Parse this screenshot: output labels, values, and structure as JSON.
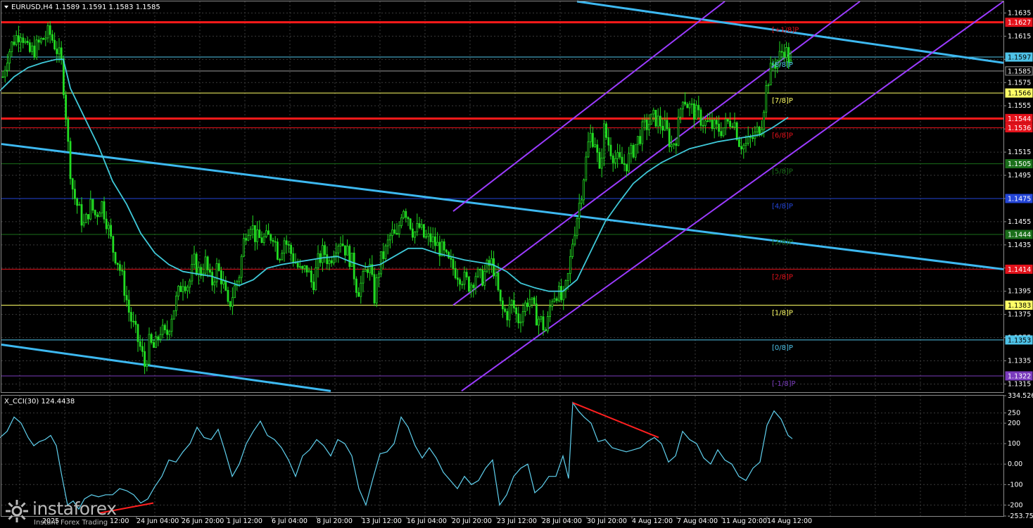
{
  "window": {
    "title": "EURUSD,H4  1.1589 1.1591 1.1583 1.1585",
    "symbol_menu_icon": "triangle-down-icon"
  },
  "indicator": {
    "label": "X_CCI(30) 124.4438",
    "scale_labels": [
      "334.5265",
      "250",
      "200",
      "100",
      "0.00",
      "-100",
      "-200",
      "-253.7534"
    ]
  },
  "price_axis": {
    "ticks": [
      "1.1635",
      "1.1615",
      "1.1595",
      "1.1575",
      "1.1555",
      "1.1535",
      "1.1515",
      "1.1495",
      "1.1475",
      "1.1455",
      "1.1435",
      "1.1415",
      "1.1395",
      "1.1375",
      "1.1355",
      "1.1335",
      "1.1315"
    ]
  },
  "price_badges": [
    {
      "value": "1.1627",
      "color": "#e3121b",
      "text": "#ffffff"
    },
    {
      "value": "1.1597",
      "color": "#4fc3e8",
      "text": "#000000"
    },
    {
      "value": "1.1585",
      "color": "#000000",
      "text": "#ffffff"
    },
    {
      "value": "1.1566",
      "color": "#ffff66",
      "text": "#000000"
    },
    {
      "value": "1.1544",
      "color": "#e3121b",
      "text": "#ffffff"
    },
    {
      "value": "1.1536",
      "color": "#e3121b",
      "text": "#ffffff"
    },
    {
      "value": "1.1505",
      "color": "#1a6f1a",
      "text": "#ffffff"
    },
    {
      "value": "1.1475",
      "color": "#2446d8",
      "text": "#ffffff"
    },
    {
      "value": "1.1444",
      "color": "#1a6f1a",
      "text": "#ffffff"
    },
    {
      "value": "1.1414",
      "color": "#e3121b",
      "text": "#ffffff"
    },
    {
      "value": "1.1383",
      "color": "#ffff66",
      "text": "#000000"
    },
    {
      "value": "1.1353",
      "color": "#4fc3e8",
      "text": "#000000"
    },
    {
      "value": "1.1322",
      "color": "#7a3bbd",
      "text": "#ffffff"
    }
  ],
  "murrey_labels": [
    {
      "text": "[+1/8]P",
      "color": "#e3121b"
    },
    {
      "text": "[8/8]P",
      "color": "#4fc3e8"
    },
    {
      "text": "[7/8]P",
      "color": "#ffff66"
    },
    {
      "text": "[6/8]P",
      "color": "#e3121b"
    },
    {
      "text": "[5/8]P",
      "color": "#1a6f1a"
    },
    {
      "text": "[4/8]P",
      "color": "#2446d8"
    },
    {
      "text": "[3/8]P",
      "color": "#1a6f1a"
    },
    {
      "text": "[2/8]P",
      "color": "#e3121b"
    },
    {
      "text": "[1/8]P",
      "color": "#ffff66"
    },
    {
      "text": "[0/8]P",
      "color": "#4fc3e8"
    },
    {
      "text": "[-1/8]P",
      "color": "#7a3bbd"
    }
  ],
  "time_axis": {
    "labels": [
      "24 Jun 04:00",
      "26 Jun 20:00",
      "1 Jul 12:00",
      "6 Jul 04:00",
      "8 Jul 20:00",
      "13 Jul 12:00",
      "16 Jul 04:00",
      "20 Jul 20:00",
      "23 Jul 12:00",
      "28 Jul 04:00",
      "30 Jul 20:00",
      "4 Aug 12:00",
      "7 Aug 04:00",
      "11 Aug 20:00",
      "14 Aug 12:00"
    ],
    "left_fragments": [
      "2025",
      "12:00"
    ]
  },
  "watermark": {
    "name": "instaforex",
    "tagline": "Instant Forex Trading",
    "icon": "instaforex-logo-icon"
  },
  "colors": {
    "background": "#000000",
    "candles": "#22dd22",
    "moving_average": "#3fc9d9",
    "trend_line": "#3db8f0",
    "channel": "#9b3bff",
    "support_resistance": "#ff1a1a",
    "cci_line": "#5fd0ee",
    "divergence": "#ff2020"
  },
  "chart_data": {
    "type": "candlestick",
    "symbol": "EURUSD",
    "timeframe": "H4",
    "last_bar": {
      "open": 1.1589,
      "high": 1.1591,
      "low": 1.1583,
      "close": 1.1585
    },
    "ylim": [
      1.1308,
      1.1645
    ],
    "cci_ylim": [
      -253.7534,
      334.5265
    ],
    "cci_period": 30,
    "cci_last": 124.4438,
    "grid": true,
    "series_close_path": [
      [
        0,
        1.1568
      ],
      [
        10,
        1.1598
      ],
      [
        20,
        1.1612
      ],
      [
        30,
        1.162
      ],
      [
        40,
        1.16
      ],
      [
        50,
        1.1604
      ],
      [
        60,
        1.1612
      ],
      [
        70,
        1.1618
      ],
      [
        80,
        1.1605
      ],
      [
        88,
        1.159
      ],
      [
        94,
        1.1545
      ],
      [
        98,
        1.151
      ],
      [
        104,
        1.148
      ],
      [
        112,
        1.1465
      ],
      [
        120,
        1.145
      ],
      [
        128,
        1.147
      ],
      [
        136,
        1.146
      ],
      [
        144,
        1.1472
      ],
      [
        152,
        1.1455
      ],
      [
        160,
        1.1432
      ],
      [
        168,
        1.142
      ],
      [
        176,
        1.14
      ],
      [
        184,
        1.1375
      ],
      [
        192,
        1.136
      ],
      [
        200,
        1.1345
      ],
      [
        206,
        1.133
      ],
      [
        212,
        1.135
      ],
      [
        220,
        1.1345
      ],
      [
        228,
        1.1362
      ],
      [
        236,
        1.1355
      ],
      [
        244,
        1.1375
      ],
      [
        252,
        1.139
      ],
      [
        260,
        1.1405
      ],
      [
        268,
        1.14
      ],
      [
        276,
        1.142
      ],
      [
        284,
        1.141
      ],
      [
        292,
        1.142
      ],
      [
        300,
        1.14
      ],
      [
        308,
        1.1415
      ],
      [
        316,
        1.1405
      ],
      [
        324,
        1.138
      ],
      [
        332,
        1.1395
      ],
      [
        340,
        1.141
      ],
      [
        348,
        1.1445
      ],
      [
        356,
        1.1455
      ],
      [
        364,
        1.144
      ],
      [
        372,
        1.144
      ],
      [
        380,
        1.144
      ],
      [
        388,
        1.1445
      ],
      [
        396,
        1.1425
      ],
      [
        404,
        1.144
      ],
      [
        412,
        1.143
      ],
      [
        420,
        1.142
      ],
      [
        428,
        1.141
      ],
      [
        436,
        1.1415
      ],
      [
        444,
        1.14
      ],
      [
        452,
        1.142
      ],
      [
        460,
        1.143
      ],
      [
        468,
        1.142
      ],
      [
        476,
        1.1435
      ],
      [
        484,
        1.144
      ],
      [
        492,
        1.143
      ],
      [
        500,
        1.142
      ],
      [
        508,
        1.1395
      ],
      [
        516,
        1.1405
      ],
      [
        524,
        1.142
      ],
      [
        532,
        1.139
      ],
      [
        540,
        1.142
      ],
      [
        548,
        1.143
      ],
      [
        556,
        1.1445
      ],
      [
        564,
        1.144
      ],
      [
        572,
        1.147
      ],
      [
        580,
        1.146
      ],
      [
        588,
        1.1445
      ],
      [
        596,
        1.145
      ],
      [
        604,
        1.144
      ],
      [
        612,
        1.144
      ],
      [
        620,
        1.1435
      ],
      [
        628,
        1.143
      ],
      [
        636,
        1.142
      ],
      [
        644,
        1.1415
      ],
      [
        652,
        1.141
      ],
      [
        660,
        1.1405
      ],
      [
        668,
        1.14
      ],
      [
        676,
        1.141
      ],
      [
        684,
        1.1405
      ],
      [
        692,
        1.1415
      ],
      [
        700,
        1.142
      ],
      [
        706,
        1.14
      ],
      [
        712,
        1.138
      ],
      [
        720,
        1.1375
      ],
      [
        728,
        1.1385
      ],
      [
        736,
        1.137
      ],
      [
        744,
        1.138
      ],
      [
        752,
        1.139
      ],
      [
        760,
        1.1375
      ],
      [
        768,
        1.137
      ],
      [
        776,
        1.136
      ],
      [
        784,
        1.139
      ],
      [
        792,
        1.1395
      ],
      [
        800,
        1.1385
      ],
      [
        808,
        1.141
      ],
      [
        814,
        1.144
      ],
      [
        820,
        1.146
      ],
      [
        826,
        1.148
      ],
      [
        832,
        1.1505
      ],
      [
        838,
        1.153
      ],
      [
        846,
        1.1525
      ],
      [
        852,
        1.1495
      ],
      [
        858,
        1.1535
      ],
      [
        866,
        1.152
      ],
      [
        874,
        1.151
      ],
      [
        882,
        1.1505
      ],
      [
        890,
        1.1505
      ],
      [
        898,
        1.1515
      ],
      [
        906,
        1.1525
      ],
      [
        914,
        1.1535
      ],
      [
        922,
        1.154
      ],
      [
        930,
        1.1545
      ],
      [
        938,
        1.154
      ],
      [
        946,
        1.1535
      ],
      [
        954,
        1.152
      ],
      [
        962,
        1.153
      ],
      [
        970,
        1.1565
      ],
      [
        978,
        1.1555
      ],
      [
        986,
        1.155
      ],
      [
        994,
        1.1545
      ],
      [
        1002,
        1.154
      ],
      [
        1010,
        1.1538
      ],
      [
        1018,
        1.1535
      ],
      [
        1026,
        1.1535
      ],
      [
        1034,
        1.154
      ],
      [
        1042,
        1.1545
      ],
      [
        1050,
        1.1525
      ],
      [
        1058,
        1.152
      ],
      [
        1066,
        1.1525
      ],
      [
        1074,
        1.153
      ],
      [
        1082,
        1.154
      ],
      [
        1090,
        1.1575
      ],
      [
        1098,
        1.159
      ],
      [
        1106,
        1.1595
      ],
      [
        1114,
        1.1605
      ],
      [
        1122,
        1.1595
      ],
      [
        1126,
        1.1585
      ]
    ],
    "series_ma_path": [
      [
        0,
        1.1568
      ],
      [
        20,
        1.158
      ],
      [
        40,
        1.1588
      ],
      [
        60,
        1.1592
      ],
      [
        80,
        1.1595
      ],
      [
        90,
        1.1595
      ],
      [
        100,
        1.157
      ],
      [
        120,
        1.1545
      ],
      [
        140,
        1.152
      ],
      [
        160,
        1.149
      ],
      [
        180,
        1.147
      ],
      [
        200,
        1.1445
      ],
      [
        220,
        1.1428
      ],
      [
        240,
        1.1418
      ],
      [
        260,
        1.1412
      ],
      [
        280,
        1.141
      ],
      [
        300,
        1.1408
      ],
      [
        320,
        1.1404
      ],
      [
        340,
        1.14
      ],
      [
        360,
        1.1405
      ],
      [
        380,
        1.1415
      ],
      [
        400,
        1.1418
      ],
      [
        420,
        1.142
      ],
      [
        440,
        1.1422
      ],
      [
        460,
        1.1424
      ],
      [
        480,
        1.1425
      ],
      [
        500,
        1.142
      ],
      [
        520,
        1.1416
      ],
      [
        540,
        1.1418
      ],
      [
        560,
        1.1425
      ],
      [
        580,
        1.1432
      ],
      [
        600,
        1.1432
      ],
      [
        620,
        1.1428
      ],
      [
        640,
        1.1425
      ],
      [
        660,
        1.1422
      ],
      [
        680,
        1.142
      ],
      [
        700,
        1.1418
      ],
      [
        720,
        1.1412
      ],
      [
        740,
        1.1402
      ],
      [
        760,
        1.1398
      ],
      [
        780,
        1.1395
      ],
      [
        800,
        1.1395
      ],
      [
        820,
        1.1405
      ],
      [
        840,
        1.143
      ],
      [
        860,
        1.1455
      ],
      [
        880,
        1.1472
      ],
      [
        900,
        1.1488
      ],
      [
        920,
        1.1498
      ],
      [
        940,
        1.1506
      ],
      [
        960,
        1.1512
      ],
      [
        980,
        1.1518
      ],
      [
        1000,
        1.1521
      ],
      [
        1020,
        1.1524
      ],
      [
        1040,
        1.1526
      ],
      [
        1060,
        1.1528
      ],
      [
        1080,
        1.153
      ],
      [
        1100,
        1.1537
      ],
      [
        1120,
        1.1545
      ]
    ],
    "cci_path": [
      [
        0,
        130
      ],
      [
        10,
        160
      ],
      [
        20,
        230
      ],
      [
        30,
        200
      ],
      [
        40,
        130
      ],
      [
        48,
        90
      ],
      [
        56,
        110
      ],
      [
        64,
        120
      ],
      [
        72,
        140
      ],
      [
        80,
        90
      ],
      [
        88,
        -60
      ],
      [
        96,
        -200
      ],
      [
        104,
        -180
      ],
      [
        112,
        -220
      ],
      [
        120,
        -170
      ],
      [
        130,
        -150
      ],
      [
        140,
        -160
      ],
      [
        150,
        -150
      ],
      [
        160,
        -150
      ],
      [
        170,
        -120
      ],
      [
        180,
        -130
      ],
      [
        190,
        -150
      ],
      [
        200,
        -190
      ],
      [
        210,
        -170
      ],
      [
        220,
        -110
      ],
      [
        230,
        -60
      ],
      [
        240,
        20
      ],
      [
        250,
        10
      ],
      [
        260,
        60
      ],
      [
        270,
        100
      ],
      [
        280,
        180
      ],
      [
        290,
        130
      ],
      [
        300,
        120
      ],
      [
        310,
        170
      ],
      [
        320,
        60
      ],
      [
        330,
        -60
      ],
      [
        340,
        0
      ],
      [
        350,
        100
      ],
      [
        360,
        160
      ],
      [
        370,
        210
      ],
      [
        380,
        140
      ],
      [
        390,
        120
      ],
      [
        400,
        80
      ],
      [
        410,
        20
      ],
      [
        420,
        -60
      ],
      [
        430,
        40
      ],
      [
        440,
        70
      ],
      [
        450,
        120
      ],
      [
        460,
        90
      ],
      [
        470,
        40
      ],
      [
        480,
        120
      ],
      [
        490,
        100
      ],
      [
        500,
        40
      ],
      [
        510,
        -120
      ],
      [
        520,
        -200
      ],
      [
        530,
        -70
      ],
      [
        540,
        50
      ],
      [
        550,
        60
      ],
      [
        560,
        100
      ],
      [
        570,
        230
      ],
      [
        580,
        180
      ],
      [
        590,
        90
      ],
      [
        600,
        30
      ],
      [
        610,
        80
      ],
      [
        620,
        30
      ],
      [
        630,
        -40
      ],
      [
        640,
        -80
      ],
      [
        650,
        -120
      ],
      [
        660,
        -60
      ],
      [
        670,
        -100
      ],
      [
        680,
        -80
      ],
      [
        690,
        -20
      ],
      [
        700,
        20
      ],
      [
        710,
        -200
      ],
      [
        720,
        -150
      ],
      [
        730,
        -60
      ],
      [
        740,
        -20
      ],
      [
        750,
        0
      ],
      [
        760,
        -140
      ],
      [
        770,
        -110
      ],
      [
        780,
        -60
      ],
      [
        790,
        -60
      ],
      [
        800,
        40
      ],
      [
        808,
        -70
      ],
      [
        814,
        300
      ],
      [
        822,
        260
      ],
      [
        830,
        230
      ],
      [
        840,
        200
      ],
      [
        850,
        110
      ],
      [
        860,
        120
      ],
      [
        870,
        80
      ],
      [
        880,
        70
      ],
      [
        890,
        60
      ],
      [
        900,
        70
      ],
      [
        910,
        80
      ],
      [
        920,
        110
      ],
      [
        930,
        130
      ],
      [
        940,
        100
      ],
      [
        950,
        10
      ],
      [
        960,
        40
      ],
      [
        970,
        160
      ],
      [
        980,
        120
      ],
      [
        990,
        100
      ],
      [
        1000,
        30
      ],
      [
        1010,
        0
      ],
      [
        1020,
        70
      ],
      [
        1030,
        20
      ],
      [
        1040,
        0
      ],
      [
        1050,
        -60
      ],
      [
        1060,
        -80
      ],
      [
        1070,
        -20
      ],
      [
        1080,
        10
      ],
      [
        1090,
        190
      ],
      [
        1100,
        260
      ],
      [
        1110,
        220
      ],
      [
        1120,
        140
      ],
      [
        1126,
        124
      ]
    ]
  }
}
